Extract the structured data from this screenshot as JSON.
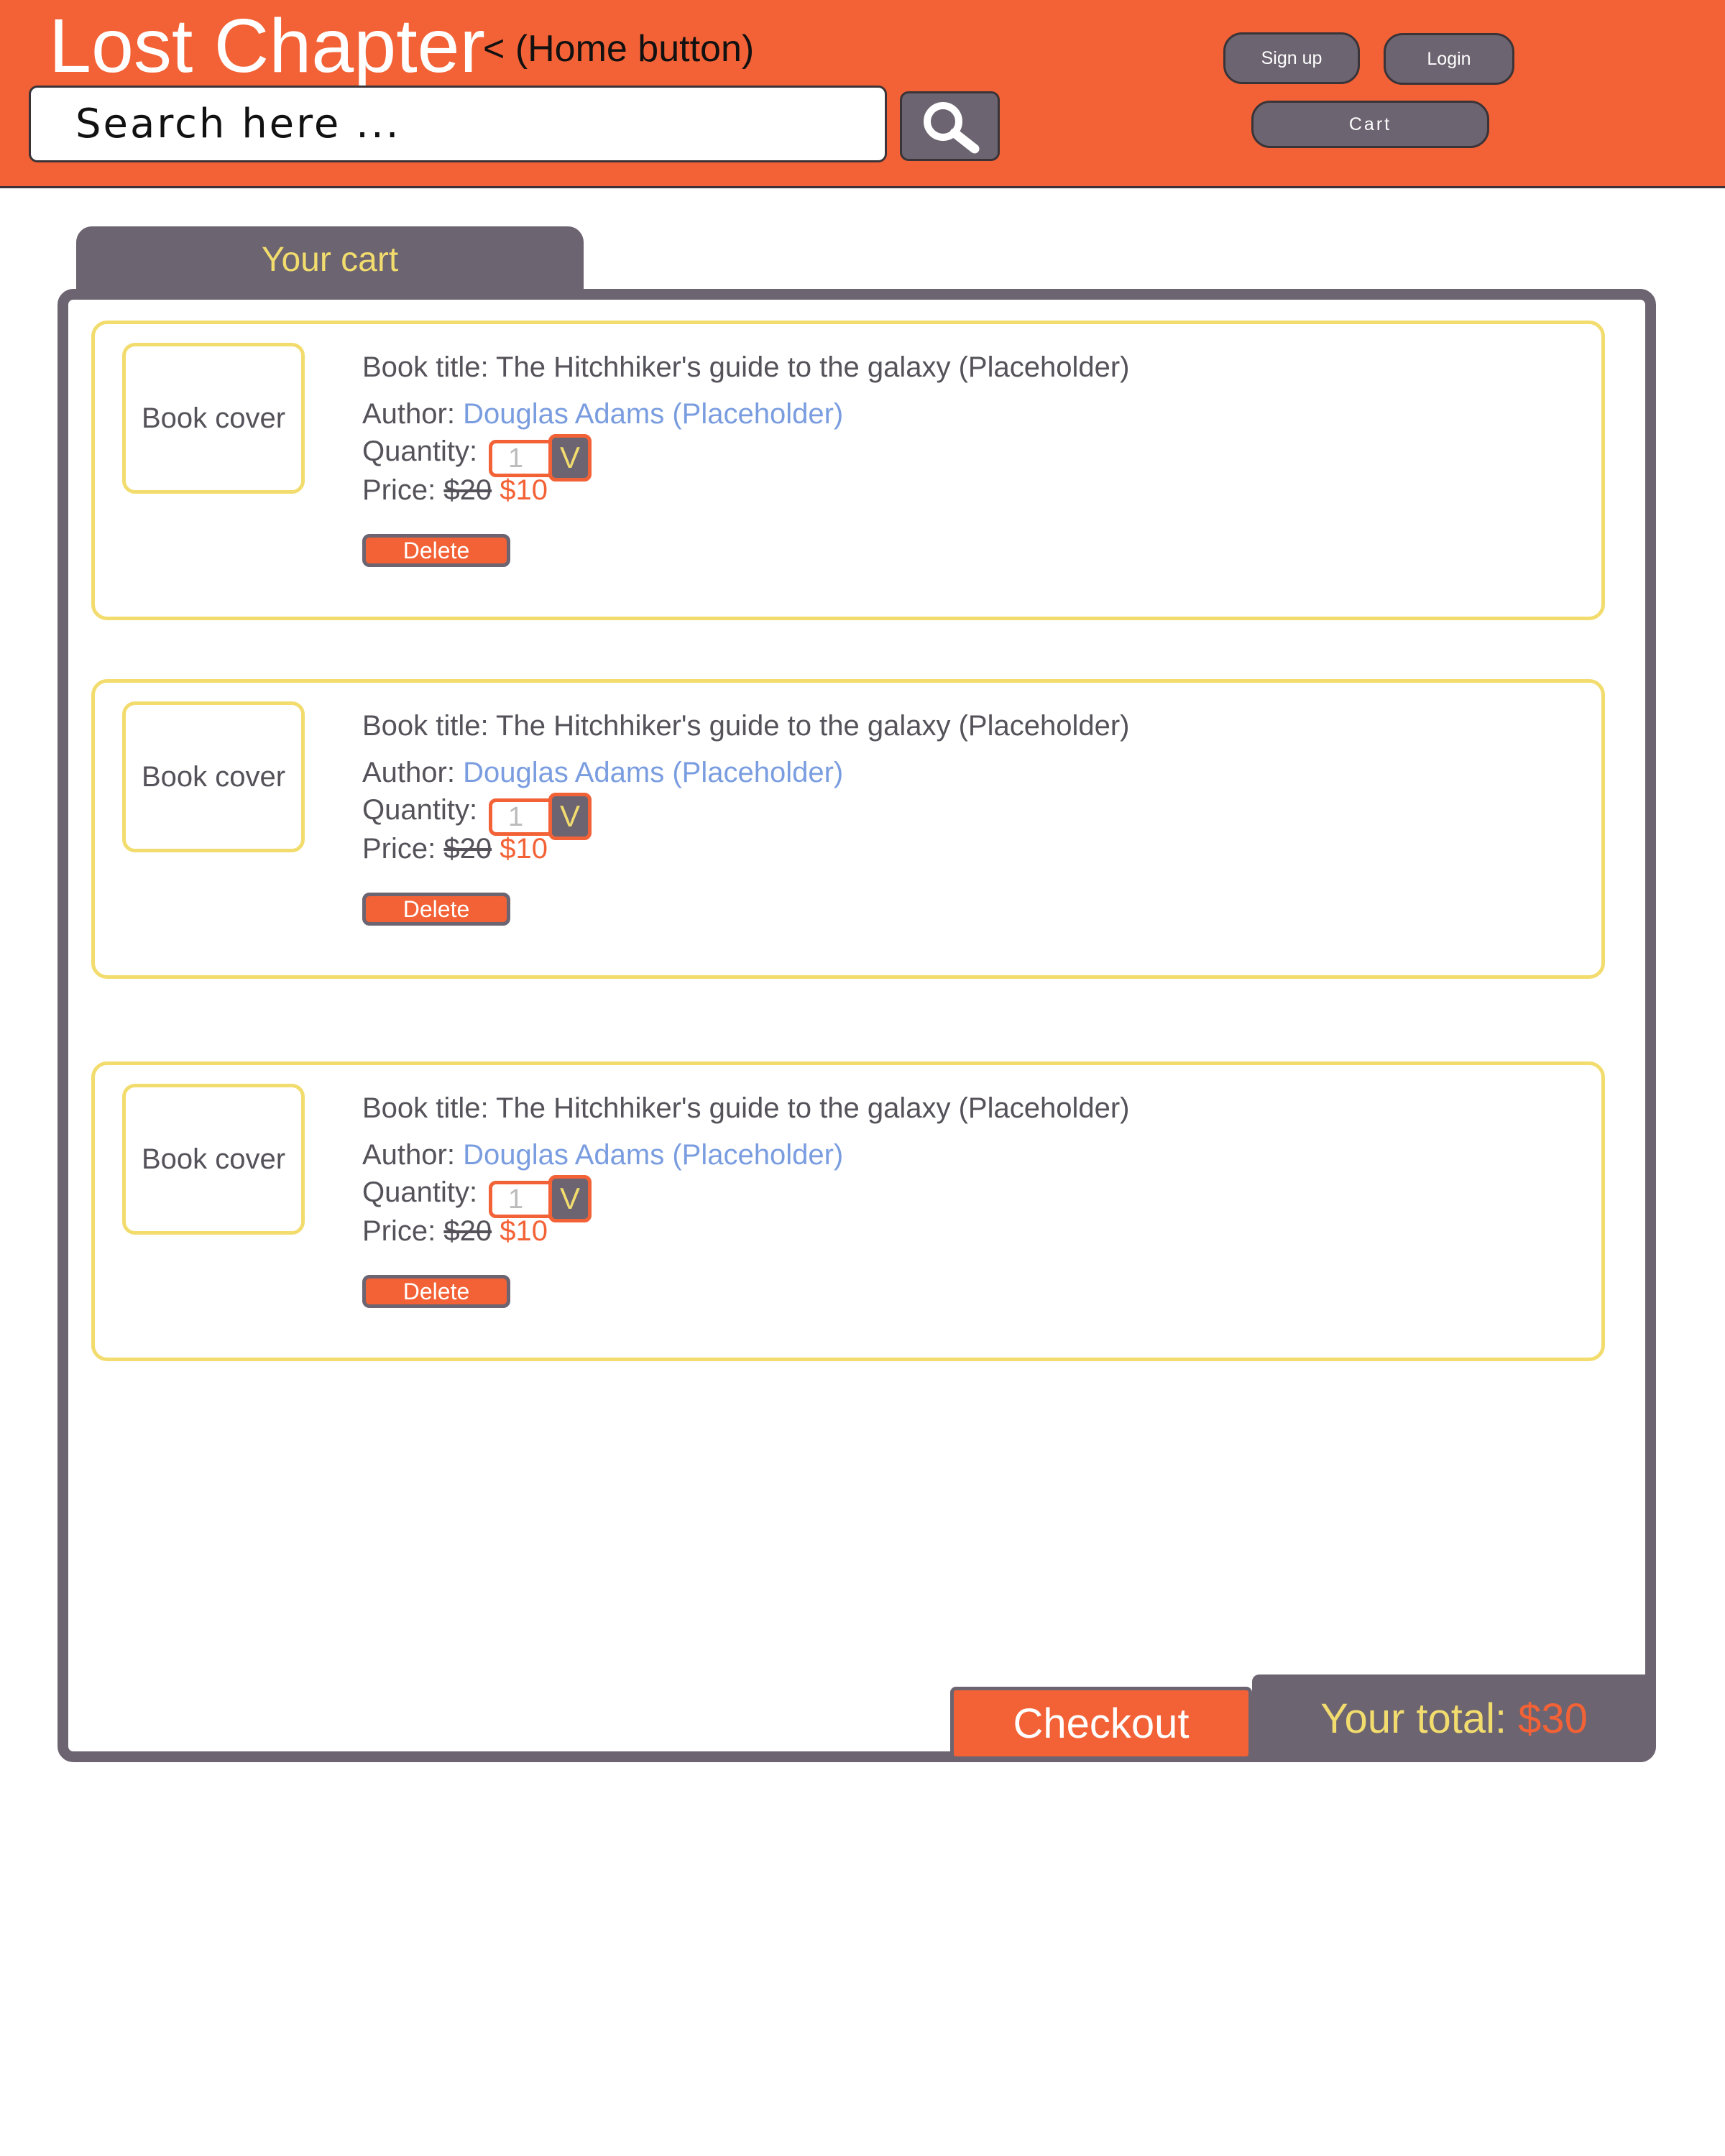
{
  "header": {
    "logo": "Lost Chapter",
    "home_note": "< (Home button)",
    "search_placeholder": "Search here ...",
    "search_icon": "magnifier-icon",
    "signup_label": "Sign up",
    "login_label": "Login",
    "cart_label": "Cart"
  },
  "cart": {
    "tab_label": "Your cart",
    "items": [
      {
        "cover": "Book cover",
        "title_line": "Book title: The Hitchhiker's guide to the galaxy (Placeholder)",
        "author_label": "Author: ",
        "author_name": "Douglas Adams (Placeholder)",
        "quantity_label": "Quantity: ",
        "quantity_value": "1",
        "quantity_toggle": "V",
        "price_label": "Price: ",
        "old_price": "$20",
        "new_price": "$10",
        "delete_label": "Delete"
      },
      {
        "cover": "Book cover",
        "title_line": "Book title: The Hitchhiker's guide to the galaxy (Placeholder)",
        "author_label": "Author: ",
        "author_name": "Douglas Adams (Placeholder)",
        "quantity_label": "Quantity: ",
        "quantity_value": "1",
        "quantity_toggle": "V",
        "price_label": "Price: ",
        "old_price": "$20",
        "new_price": "$10",
        "delete_label": "Delete"
      },
      {
        "cover": "Book cover",
        "title_line": "Book title: The Hitchhiker's guide to the galaxy (Placeholder)",
        "author_label": "Author: ",
        "author_name": "Douglas Adams (Placeholder)",
        "quantity_label": "Quantity: ",
        "quantity_value": "1",
        "quantity_toggle": "V",
        "price_label": "Price: ",
        "old_price": "$20",
        "new_price": "$10",
        "delete_label": "Delete"
      }
    ],
    "checkout_label": "Checkout",
    "total_label": "Your total:",
    "total_amount": "$30"
  },
  "colors": {
    "brand_orange": "#f36236",
    "panel_gray": "#6c6470",
    "accent_yellow": "#f2dc6e",
    "author_blue": "#7a9de0"
  }
}
